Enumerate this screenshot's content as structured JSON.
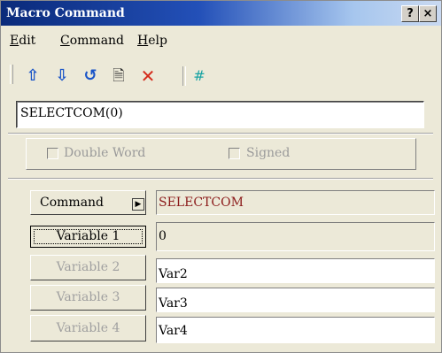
{
  "window": {
    "title": "Macro Command",
    "help_btn": "?",
    "close_btn": "×"
  },
  "menubar": {
    "items": [
      {
        "hot": "E",
        "rest": "dit"
      },
      {
        "hot": "C",
        "rest": "ommand"
      },
      {
        "hot": "H",
        "rest": "elp"
      }
    ]
  },
  "toolbar": {
    "icons": [
      {
        "name": "move-up-arrow-icon",
        "glyph": "⇧"
      },
      {
        "name": "move-down-arrow-icon",
        "glyph": "⇩"
      },
      {
        "name": "refresh-icon",
        "glyph": "↺"
      },
      {
        "name": "document-icon",
        "glyph": "🗎"
      },
      {
        "name": "delete-x-icon",
        "glyph": "✕"
      },
      {
        "name": "hash-icon",
        "glyph": "#"
      }
    ]
  },
  "command_line": "SELECTCOM(0)",
  "options": {
    "double_word": "Double Word",
    "signed": "Signed"
  },
  "command": {
    "label": "Command",
    "value": "SELECTCOM",
    "value_color": "#8b1a1a"
  },
  "variables": [
    {
      "label": "Variable 1",
      "value": "0"
    },
    {
      "label": "Variable 2",
      "value": "Var2"
    },
    {
      "label": "Variable 3",
      "value": "Var3"
    },
    {
      "label": "Variable 4",
      "value": "Var4"
    }
  ]
}
